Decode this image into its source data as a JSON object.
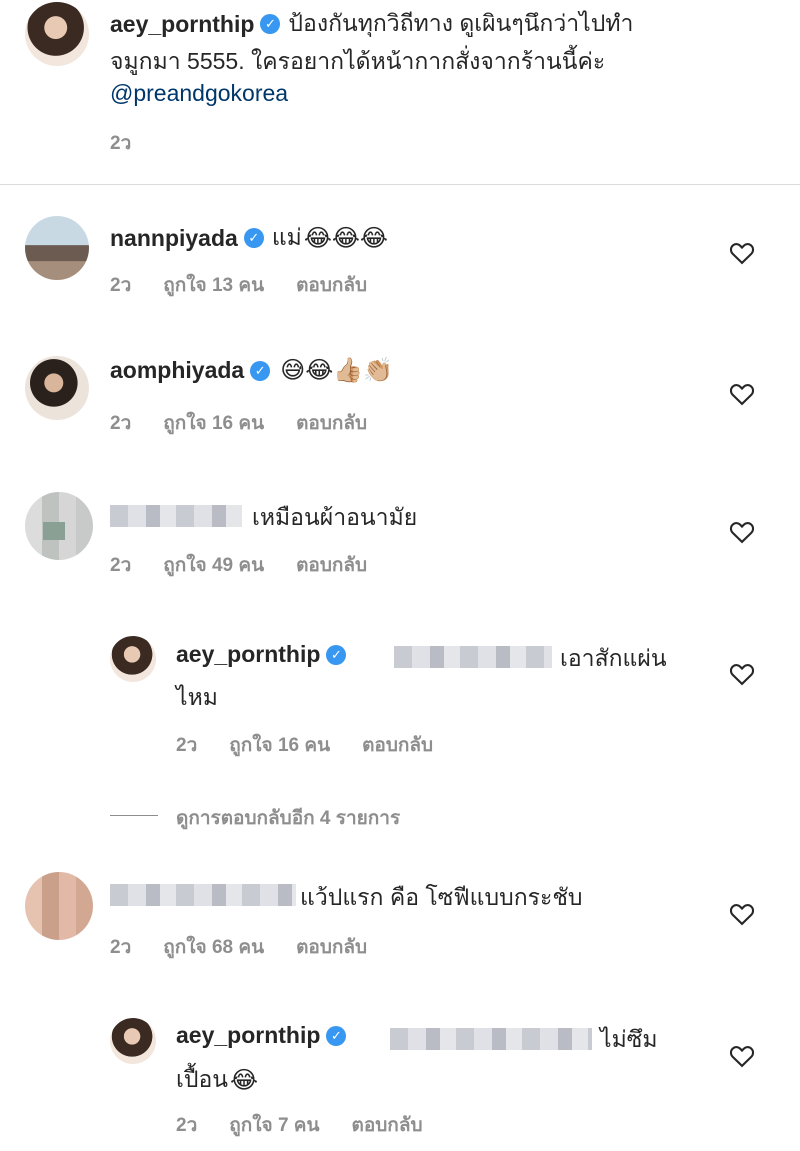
{
  "caption": {
    "username": "aey_pornthip",
    "verified": "✓",
    "line1": "ป้องกันทุกวิถีทาง ดูเผินๆนึกว่าไปทำ",
    "line2": "จมูกมา 5555. ใครอยากได้หน้ากากสั่งจากร้านนี้ค่ะ",
    "mention": "@preandgokorea",
    "time": "2ว"
  },
  "comments": [
    {
      "username": "nannpiyada",
      "verified": "✓",
      "text": "แม่",
      "emoji": "😂😂😂",
      "time": "2ว",
      "likes": "ถูกใจ 13 คน",
      "reply": "ตอบกลับ"
    },
    {
      "username": "aomphiyada",
      "verified": "✓",
      "text": "",
      "emoji": "😅😂👍🏼👏🏼",
      "time": "2ว",
      "likes": "ถูกใจ 16 คน",
      "reply": "ตอบกลับ"
    },
    {
      "username": "",
      "text": "เหมือนผ้าอนามัย",
      "time": "2ว",
      "likes": "ถูกใจ 49 คน",
      "reply": "ตอบกลับ"
    },
    {
      "username": "",
      "text": "แว้ปแรก คือ โซฟีแบบกระชับ",
      "time": "2ว",
      "likes": "ถูกใจ 68 คน",
      "reply": "ตอบกลับ"
    }
  ],
  "replies": [
    {
      "username": "aey_pornthip",
      "verified": "✓",
      "text_line1": "เอาสักแผ่น",
      "text_line2": "ไหม",
      "time": "2ว",
      "likes": "ถูกใจ 16 คน",
      "reply": "ตอบกลับ"
    },
    {
      "username": "aey_pornthip",
      "verified": "✓",
      "text_line1": "ไม่ซึม",
      "text_line2": "เปื้อน",
      "emoji": "😂",
      "time": "2ว",
      "likes": "ถูกใจ 7 คน",
      "reply": "ตอบกลับ"
    }
  ],
  "view_replies": "ดูการตอบกลับอีก 4 รายการ",
  "icons": {
    "like": "heart-outline-icon",
    "verified": "verified-badge-icon"
  }
}
